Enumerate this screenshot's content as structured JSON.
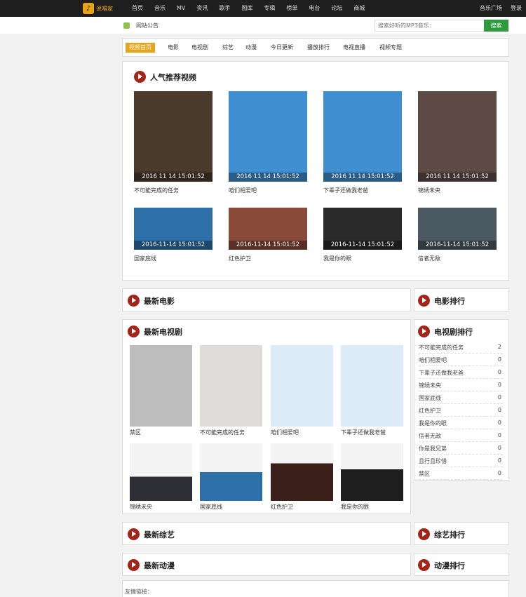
{
  "topbar": {
    "logo_text": "说唱家",
    "nav": [
      "首页",
      "音乐",
      "MV",
      "资讯",
      "歌手",
      "图库",
      "专辑",
      "榜单",
      "电台",
      "论坛",
      "商城"
    ],
    "right": [
      "音乐广场",
      "登录"
    ]
  },
  "subbar": {
    "notice": "网站公告",
    "search_placeholder": "搜索好听的MP3音乐：",
    "search_button": "搜索"
  },
  "tabs": [
    "视频首页",
    "电影",
    "电视剧",
    "综艺",
    "动漫",
    "今日更新",
    "播放排行",
    "电视直播",
    "视频专题"
  ],
  "popular": {
    "title": "人气推荐视频",
    "row1": [
      {
        "caption": "不可能完成的任务",
        "time": "2016 11 14 15:01:52",
        "color": "#4a3a2c"
      },
      {
        "caption": "咱们相爱吧",
        "time": "2016 11 14 15:01:52",
        "color": "#3f8fd0"
      },
      {
        "caption": "下辈子还做我老爸",
        "time": "2016 11 14 15:01:52",
        "color": "#3f8fd0"
      },
      {
        "caption": "锦绣未央",
        "time": "2016 11 14 15:01:52",
        "color": "#5e4a45"
      }
    ],
    "row2": [
      {
        "caption": "国家底线",
        "time": "2016-11-14 15:01:52",
        "color": "#2d6fa8"
      },
      {
        "caption": "红色护卫",
        "time": "2016-11-14 15:01:52",
        "color": "#8a4a3a"
      },
      {
        "caption": "我是你的眼",
        "time": "2016-11-14 15:01:52",
        "color": "#2a2a2a"
      },
      {
        "caption": "信者无敌",
        "time": "2016-11-14 15:01:52",
        "color": "#4b5a62"
      }
    ]
  },
  "latest_movie": {
    "title": "最新电影"
  },
  "movie_rank": {
    "title": "电影排行"
  },
  "latest_tv": {
    "title": "最新电视剧",
    "row1": [
      {
        "caption": "禁区",
        "color": "#bdbdbd"
      },
      {
        "caption": "不可能完成的任务",
        "color": "#4a3a2c"
      },
      {
        "caption": "咱们相爱吧",
        "color": "#3f8fd0"
      },
      {
        "caption": "下辈子还做我老爸",
        "color": "#3f8fd0"
      }
    ],
    "row2": [
      {
        "caption": "锦绣未央",
        "color": "#2e2e36"
      },
      {
        "caption": "国家底线",
        "color": "#2d6fa8"
      },
      {
        "caption": "红色护卫",
        "color": "#3a1f1a"
      },
      {
        "caption": "我是你的眼",
        "color": "#1f1f1f"
      }
    ]
  },
  "tv_rank": {
    "title": "电视剧排行",
    "items": [
      {
        "name": "不可能完成的任务",
        "count": "2"
      },
      {
        "name": "咱们相爱吧",
        "count": "0"
      },
      {
        "name": "下辈子还做我老爸",
        "count": "0"
      },
      {
        "name": "锦绣未央",
        "count": "0"
      },
      {
        "name": "国家底线",
        "count": "0"
      },
      {
        "name": "红色护卫",
        "count": "0"
      },
      {
        "name": "我是你的眼",
        "count": "0"
      },
      {
        "name": "信者无敌",
        "count": "0"
      },
      {
        "name": "你是我兄弟",
        "count": "0"
      },
      {
        "name": "且行且珍惜",
        "count": "0"
      },
      {
        "name": "禁区",
        "count": "0"
      }
    ]
  },
  "latest_variety": {
    "title": "最新综艺"
  },
  "variety_rank": {
    "title": "综艺排行"
  },
  "latest_anime": {
    "title": "最新动漫"
  },
  "anime_rank": {
    "title": "动漫排行"
  },
  "links": {
    "label": "友情链接："
  },
  "colors": {
    "accent": "#e8a317",
    "title_icon": "#a4241a",
    "search_button": "#2c9a3d",
    "topbar": "#1f1f1f"
  }
}
